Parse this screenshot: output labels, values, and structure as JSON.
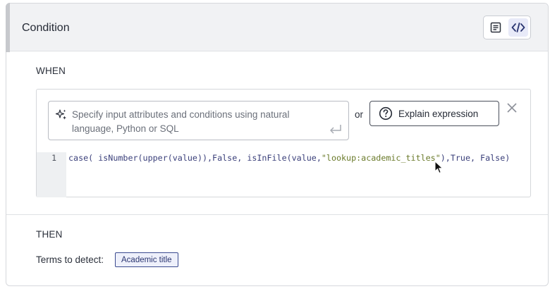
{
  "header": {
    "title": "Condition"
  },
  "toggle": {
    "items": [
      {
        "icon": "document-icon",
        "active": false
      },
      {
        "icon": "code-icon",
        "active": true
      }
    ]
  },
  "when": {
    "label": "WHEN",
    "nl_input": {
      "placeholder": "Specify input attributes and conditions using natural language, Python or SQL"
    },
    "or_label": "or",
    "explain_button": "Explain expression",
    "editor": {
      "line_number": "1",
      "code_prefix": "case( isNumber(upper(value)),False, isInFile(value,",
      "code_string": "\"lookup:academic_titles\"",
      "code_suffix": "),True, False)"
    }
  },
  "then": {
    "label": "THEN",
    "terms_label": "Terms to detect:",
    "tag": "Academic title"
  },
  "colors": {
    "accent": "#3b4a8f",
    "header_bg": "#f1f2f4",
    "string": "#6a7a2a"
  }
}
